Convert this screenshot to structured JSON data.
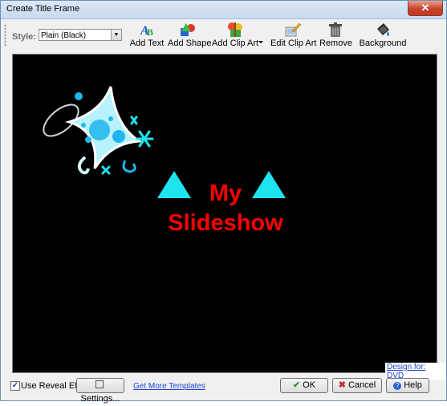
{
  "window": {
    "title": "Create Title Frame",
    "close_glyph": "✕"
  },
  "toolbar": {
    "style_label": "Style:",
    "style_value": "Plain (Black)",
    "buttons": [
      {
        "label": "Add Text",
        "icon": "add-text-icon"
      },
      {
        "label": "Add Shape",
        "icon": "add-shape-icon"
      },
      {
        "label": "Add Clip Art",
        "icon": "add-clip-art-icon"
      },
      {
        "label": "Edit Clip Art",
        "icon": "edit-clip-art-icon"
      },
      {
        "label": "Remove",
        "icon": "trash-icon"
      },
      {
        "label": "Background",
        "icon": "paint-bucket-icon"
      }
    ]
  },
  "canvas": {
    "background": "#000000",
    "title_line1": "My",
    "title_line2": "Slideshow",
    "text_color": "#ff0000",
    "shape_color": "#1fe3ee"
  },
  "design_for": "Design for: DVD",
  "bottom": {
    "reveal_label": "Use Reveal Effect",
    "reveal_checked": true,
    "settings_label": "Settings...",
    "templates_link": "Get More Templates",
    "ok_label": "OK",
    "cancel_label": "Cancel",
    "help_label": "Help"
  }
}
